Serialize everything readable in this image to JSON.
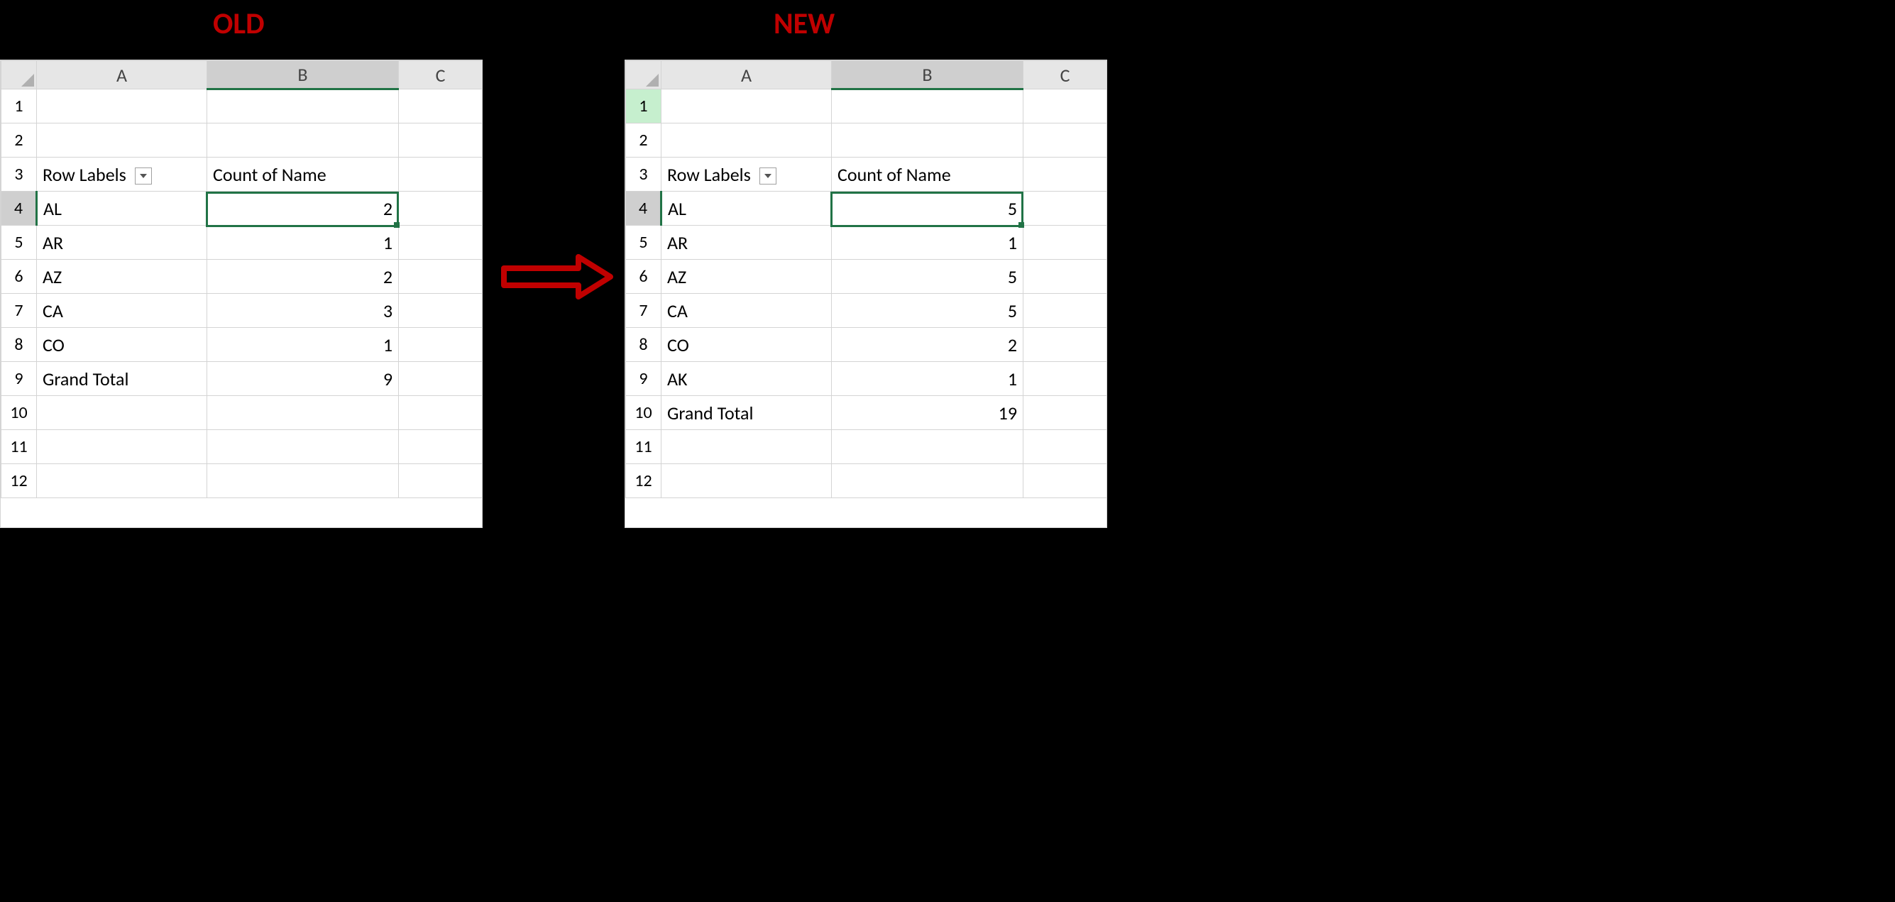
{
  "labels": {
    "old": "OLD",
    "new": "NEW"
  },
  "columns": [
    "A",
    "B",
    "C"
  ],
  "pivot_headers": {
    "row_labels": "Row Labels",
    "count": "Count of Name"
  },
  "grand_total_label": "Grand Total",
  "old": {
    "row_numbers": [
      "1",
      "2",
      "3",
      "4",
      "5",
      "6",
      "7",
      "8",
      "9",
      "10",
      "11",
      "12"
    ],
    "items": [
      {
        "label": "AL",
        "value": 2
      },
      {
        "label": "AR",
        "value": 1
      },
      {
        "label": "AZ",
        "value": 2
      },
      {
        "label": "CA",
        "value": 3
      },
      {
        "label": "CO",
        "value": 1
      }
    ],
    "grand_total": 9,
    "active_cell": "B4",
    "selected_rowhdr": "4",
    "selected_colhdr": "B"
  },
  "new": {
    "row_numbers": [
      "1",
      "2",
      "3",
      "4",
      "5",
      "6",
      "7",
      "8",
      "9",
      "10",
      "11",
      "12"
    ],
    "items": [
      {
        "label": "AL",
        "value": 5
      },
      {
        "label": "AR",
        "value": 1
      },
      {
        "label": "AZ",
        "value": 5
      },
      {
        "label": "CA",
        "value": 5
      },
      {
        "label": "CO",
        "value": 2
      },
      {
        "label": "AK",
        "value": 1
      }
    ],
    "grand_total": 19,
    "active_cell": "B4",
    "selected_rowhdr_green": "1",
    "selected_rowhdr": "4",
    "selected_colhdr": "B"
  }
}
